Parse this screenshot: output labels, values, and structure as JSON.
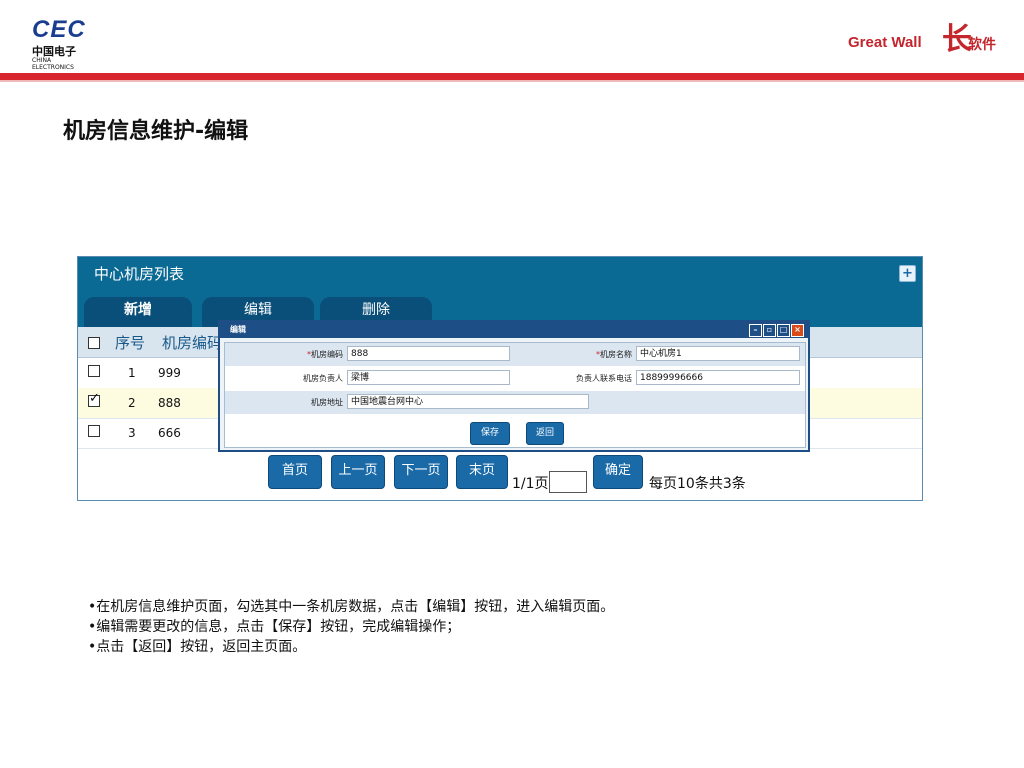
{
  "header": {
    "cec_logo": "CEC",
    "cec_cn": "中国电子",
    "cec_en": "CHINA ELECTRONICS",
    "gw_logo": "Great Wall",
    "gw_char": "长",
    "gw_sub": "软件"
  },
  "slide_title": "机房信息维护-编辑",
  "panel": {
    "title": "中心机房列表",
    "toolbar": {
      "add": "新增",
      "edit": "编辑",
      "delete": "删除"
    },
    "columns": [
      "序号",
      "机房编码"
    ],
    "rows": [
      {
        "index": "1",
        "code": "999",
        "checked": false
      },
      {
        "index": "2",
        "code": "888",
        "checked": true
      },
      {
        "index": "3",
        "code": "666",
        "checked": false
      }
    ],
    "pager": {
      "first": "首页",
      "prev": "上一页",
      "next": "下一页",
      "last": "末页",
      "info": "1/1页",
      "confirm": "确定",
      "summary": "每页10条共3条"
    }
  },
  "dialog": {
    "title": "编辑",
    "labels": {
      "code": "机房编码",
      "name": "机房名称",
      "manager": "机房负责人",
      "phone": "负责人联系电话",
      "address": "机房地址"
    },
    "values": {
      "code": "888",
      "name": "中心机房1",
      "manager": "梁博",
      "phone": "18899996666",
      "address": "中国地震台网中心"
    },
    "save": "保存",
    "back": "返回"
  },
  "notes": [
    "•在机房信息维护页面，勾选其中一条机房数据，点击【编辑】按钮，进入编辑页面。",
    "•编辑需要更改的信息，点击【保存】按钮，完成编辑操作；",
    "•点击【返回】按钮，返回主页面。"
  ],
  "colors": {
    "accent_red": "#d8262f",
    "panel_blue": "#0a6a94",
    "dialog_blue": "#1d4f86"
  }
}
